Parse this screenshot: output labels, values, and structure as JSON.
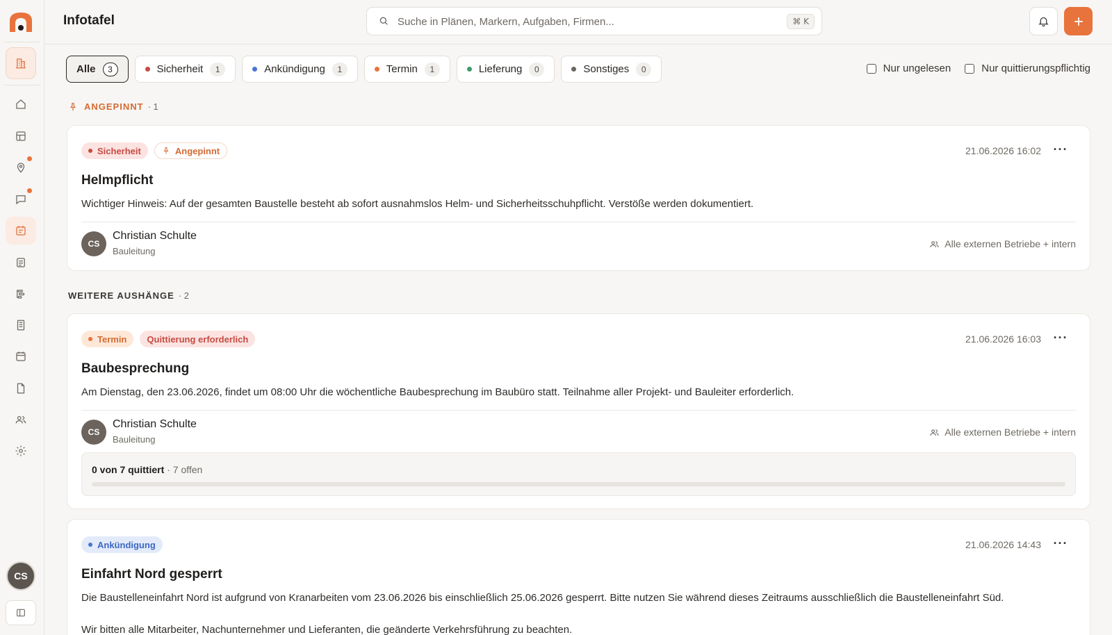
{
  "colors": {
    "accent": "#e9733c",
    "sicherheit": "#c74b43",
    "ankuendigung": "#4a74d0",
    "termin": "#e9733c",
    "lieferung": "#3f9a6a",
    "sonstiges": "#6b6660"
  },
  "header": {
    "title": "Infotafel",
    "search_placeholder": "Suche in Plänen, Markern, Aufgaben, Firmen...",
    "shortcut": "⌘ K"
  },
  "sidebar": {
    "user_initials": "CS",
    "items": [
      {
        "name": "home-icon"
      },
      {
        "name": "table-icon"
      },
      {
        "name": "map-pin-icon",
        "dot": true
      },
      {
        "name": "chat-icon",
        "dot": true
      },
      {
        "name": "noticeboard-icon",
        "active": true
      },
      {
        "name": "document-icon"
      },
      {
        "name": "gantt-icon"
      },
      {
        "name": "report-icon"
      },
      {
        "name": "calendar-icon"
      },
      {
        "name": "file-icon"
      },
      {
        "name": "users-icon"
      },
      {
        "name": "gear-icon"
      }
    ]
  },
  "filters": {
    "chips": [
      {
        "label": "Alle",
        "count": "3"
      },
      {
        "label": "Sicherheit",
        "count": "1"
      },
      {
        "label": "Ankündigung",
        "count": "1"
      },
      {
        "label": "Termin",
        "count": "1"
      },
      {
        "label": "Lieferung",
        "count": "0"
      },
      {
        "label": "Sonstiges",
        "count": "0"
      }
    ],
    "checks": [
      "Nur ungelesen",
      "Nur quittierungspflichtig"
    ]
  },
  "sections": {
    "pinned": {
      "label": "ANGEPINNT",
      "count": "· 1"
    },
    "more": {
      "label": "WEITERE AUSHÄNGE",
      "count": "· 2"
    }
  },
  "cards": [
    {
      "tags": [
        "Sicherheit",
        "Angepinnt"
      ],
      "date": "21.06.2026 16:02",
      "title": "Helmpflicht",
      "body": "Wichtiger Hinweis: Auf der gesamten Baustelle besteht ab sofort ausnahmslos Helm- und Sicherheitsschuhpflicht. Verstöße werden dokumentiert.",
      "author": {
        "initials": "CS",
        "name": "Christian Schulte",
        "role": "Bauleitung"
      },
      "audience": "Alle externen Betriebe + intern"
    },
    {
      "tags": [
        "Termin",
        "Quittierung erforderlich"
      ],
      "date": "21.06.2026 16:03",
      "title": "Baubesprechung",
      "body": "Am Dienstag, den 23.06.2026, findet um 08:00 Uhr die wöchentliche Baubesprechung im Baubüro statt. Teilnahme aller Projekt- und Bauleiter erforderlich.",
      "author": {
        "initials": "CS",
        "name": "Christian Schulte",
        "role": "Bauleitung"
      },
      "audience": "Alle externen Betriebe + intern",
      "ack": {
        "text": "0 von 7 quittiert",
        "sub": "· 7 offen",
        "progress": 0
      }
    },
    {
      "tags": [
        "Ankündigung"
      ],
      "date": "21.06.2026 14:43",
      "title": "Einfahrt Nord gesperrt",
      "body": "Die Baustelleneinfahrt Nord ist aufgrund von Kranarbeiten vom 23.06.2026 bis einschließlich 25.06.2026 gesperrt. Bitte nutzen Sie während dieses Zeitraums ausschließlich die Baustelleneinfahrt Süd.",
      "body2": "Wir bitten alle Mitarbeiter, Nachunternehmer und Lieferanten, die geänderte Verkehrsführung zu beachten."
    }
  ]
}
